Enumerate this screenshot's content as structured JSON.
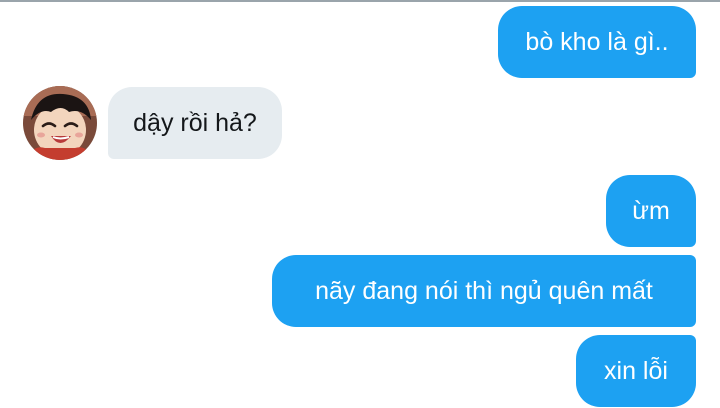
{
  "conversation": {
    "messages": [
      {
        "sender": "me",
        "text": "bò kho là gì.."
      },
      {
        "sender": "them",
        "text": "dậy rồi hả?"
      },
      {
        "sender": "me",
        "text": "ừm"
      },
      {
        "sender": "me",
        "text": "nãy đang nói thì ngủ quên mất"
      },
      {
        "sender": "me",
        "text": "xin lỗi"
      }
    ],
    "colors": {
      "sent_bubble": "#1da1f2",
      "received_bubble": "#e6ecf0",
      "sent_text": "#ffffff",
      "received_text": "#14171a"
    },
    "contact": {
      "avatar_icon": "anime-character-avatar-icon"
    }
  }
}
